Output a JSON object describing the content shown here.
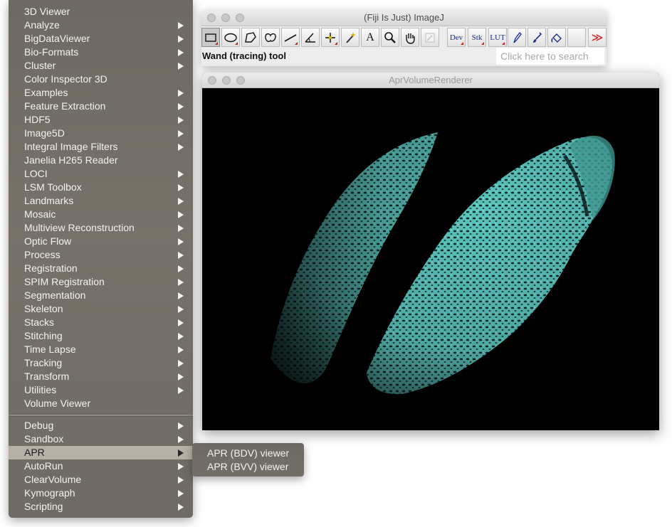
{
  "menu": {
    "items": [
      {
        "label": "3D Viewer",
        "submenu": false
      },
      {
        "label": "Analyze",
        "submenu": true
      },
      {
        "label": "BigDataViewer",
        "submenu": true
      },
      {
        "label": "Bio-Formats",
        "submenu": true
      },
      {
        "label": "Cluster",
        "submenu": true
      },
      {
        "label": "Color Inspector 3D",
        "submenu": false
      },
      {
        "label": "Examples",
        "submenu": true
      },
      {
        "label": "Feature Extraction",
        "submenu": true
      },
      {
        "label": "HDF5",
        "submenu": true
      },
      {
        "label": "Image5D",
        "submenu": true
      },
      {
        "label": "Integral Image Filters",
        "submenu": true
      },
      {
        "label": "Janelia H265 Reader",
        "submenu": false
      },
      {
        "label": "LOCI",
        "submenu": true
      },
      {
        "label": "LSM Toolbox",
        "submenu": true
      },
      {
        "label": "Landmarks",
        "submenu": true
      },
      {
        "label": "Mosaic",
        "submenu": true
      },
      {
        "label": "Multiview Reconstruction",
        "submenu": true
      },
      {
        "label": "Optic Flow",
        "submenu": true
      },
      {
        "label": "Process",
        "submenu": true
      },
      {
        "label": "Registration",
        "submenu": true
      },
      {
        "label": "SPIM Registration",
        "submenu": true
      },
      {
        "label": "Segmentation",
        "submenu": true
      },
      {
        "label": "Skeleton",
        "submenu": true
      },
      {
        "label": "Stacks",
        "submenu": true
      },
      {
        "label": "Stitching",
        "submenu": true
      },
      {
        "label": "Time Lapse",
        "submenu": true
      },
      {
        "label": "Tracking",
        "submenu": true
      },
      {
        "label": "Transform",
        "submenu": true
      },
      {
        "label": "Utilities",
        "submenu": true
      },
      {
        "label": "Volume Viewer",
        "submenu": false
      }
    ],
    "items_after_separator": [
      {
        "label": "Debug",
        "submenu": true
      },
      {
        "label": "Sandbox",
        "submenu": true
      },
      {
        "label": "APR",
        "submenu": true,
        "highlighted": true
      },
      {
        "label": "AutoRun",
        "submenu": true
      },
      {
        "label": "ClearVolume",
        "submenu": true
      },
      {
        "label": "Kymograph",
        "submenu": true
      },
      {
        "label": "Scripting",
        "submenu": true
      }
    ]
  },
  "submenu": {
    "items": [
      {
        "label": "APR (BDV) viewer"
      },
      {
        "label": "APR (BVV) viewer"
      }
    ]
  },
  "imagej": {
    "title": "(Fiji Is Just) ImageJ",
    "status": "Wand (tracing) tool",
    "search_placeholder": "Click here to search",
    "tools": [
      {
        "name": "rectangle-tool-icon",
        "selected": true,
        "corner": true
      },
      {
        "name": "oval-tool-icon",
        "corner": true
      },
      {
        "name": "polygon-tool-icon"
      },
      {
        "name": "freehand-tool-icon"
      },
      {
        "name": "line-tool-icon",
        "corner": true
      },
      {
        "name": "angle-tool-icon"
      },
      {
        "name": "point-tool-icon",
        "corner": true
      },
      {
        "name": "wand-tool-icon"
      },
      {
        "name": "text-tool-icon",
        "text": "A"
      },
      {
        "name": "magnifier-tool-icon"
      },
      {
        "name": "hand-tool-icon"
      },
      {
        "name": "color-picker-tool-icon"
      },
      {
        "name": "dev-menu-icon",
        "text": "Dev",
        "corner": true
      },
      {
        "name": "stk-menu-icon",
        "text": "Stk",
        "corner": true
      },
      {
        "name": "lut-menu-icon",
        "text": "LUT",
        "corner": true
      },
      {
        "name": "pencil-tool-icon"
      },
      {
        "name": "brush-tool-icon"
      },
      {
        "name": "flood-fill-tool-icon"
      },
      {
        "name": "blank-slot-icon"
      },
      {
        "name": "more-tools-icon",
        "text": "≫"
      }
    ]
  },
  "renderer": {
    "title": "AprVolumeRenderer",
    "volume_color": "#6fd6cf",
    "background_color": "#000000"
  },
  "colors": {
    "menu_bg": "#736e67",
    "menu_highlight": "#b7b0a6",
    "accent_red": "#d21a1a",
    "tool_text_blue": "#1a2e8c"
  }
}
